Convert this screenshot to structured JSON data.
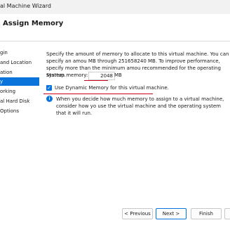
{
  "window": {
    "title": "al Machine Wizard"
  },
  "header": {
    "title": "Assign Memory"
  },
  "sidebar": {
    "items": [
      {
        "label": "gin",
        "selected": false
      },
      {
        "label": "and Location",
        "selected": false
      },
      {
        "label": "ation",
        "selected": false
      },
      {
        "label": "y",
        "selected": true
      },
      {
        "label": "orking",
        "selected": false
      },
      {
        "label": "al Hard Disk",
        "selected": false
      },
      {
        "label": "Options",
        "selected": false
      }
    ]
  },
  "main": {
    "description": "Specify the amount of memory to allocate to this virtual machine. You can specify an amou MB through 251658240 MB. To improve performance, specify more than the minimum amou recommended for the operating system.",
    "startup_memory_label": "Startup memory:",
    "startup_memory_value": "2048",
    "startup_memory_unit": "MB",
    "dynamic_memory_label": "Use Dynamic Memory for this virtual machine.",
    "dynamic_memory_checked": true,
    "info_text": "When you decide how much memory to assign to a virtual machine, consider how yo use the virtual machine and the operating system that it will run."
  },
  "footer": {
    "previous_label": "< Previous",
    "next_label": "Next >",
    "finish_label": "Finish"
  },
  "colors": {
    "accent": "#0a74da",
    "annotation": "#d0021b"
  }
}
